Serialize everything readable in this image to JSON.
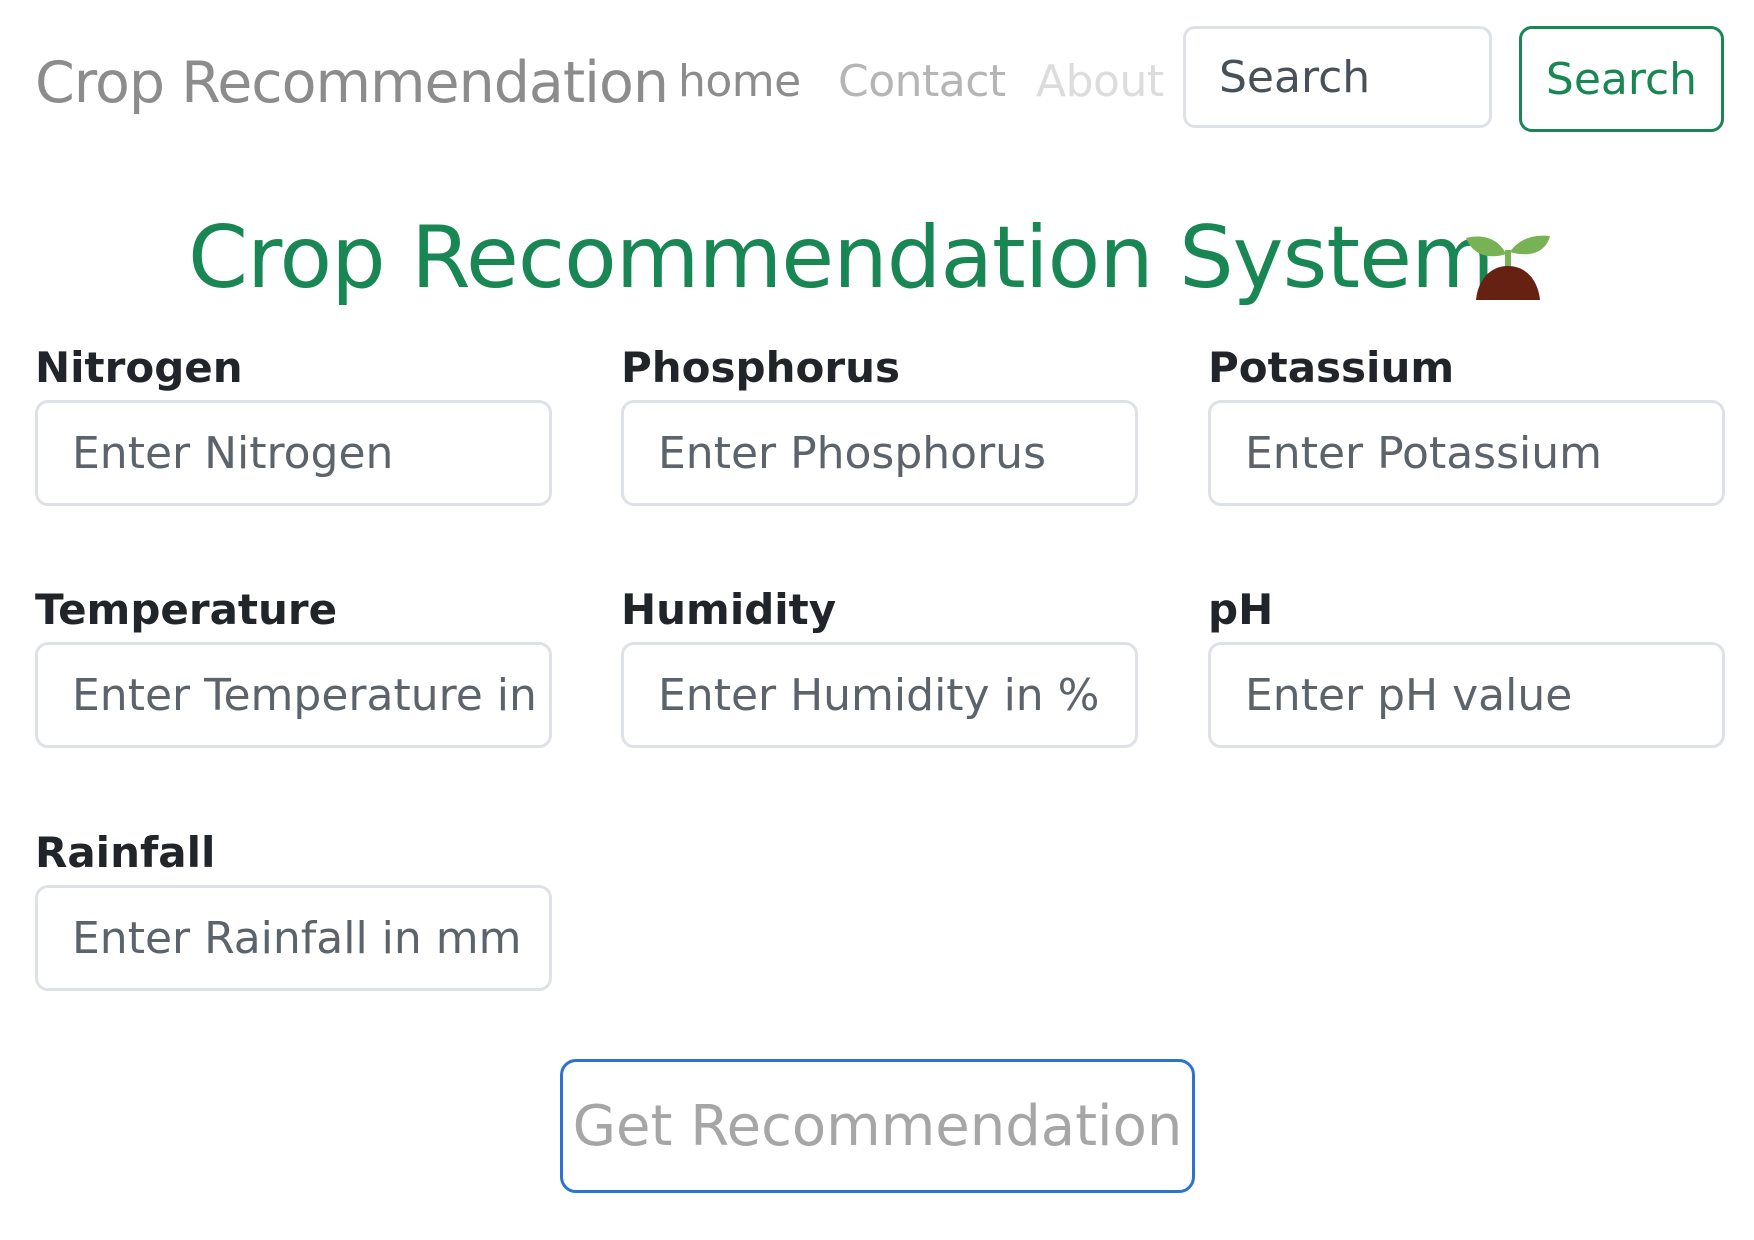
{
  "navbar": {
    "brand": "Crop Recommendation",
    "links": [
      "home",
      "Contact",
      "About"
    ],
    "search_placeholder": "Search",
    "search_button": "Search"
  },
  "main": {
    "title": "Crop Recommendation System",
    "title_icon": "seedling-icon",
    "fields": [
      {
        "label": "Nitrogen",
        "placeholder": "Enter Nitrogen",
        "value": ""
      },
      {
        "label": "Phosphorus",
        "placeholder": "Enter Phosphorus",
        "value": ""
      },
      {
        "label": "Potassium",
        "placeholder": "Enter Potassium",
        "value": ""
      },
      {
        "label": "Temperature",
        "placeholder": "Enter Temperature in °C",
        "value": ""
      },
      {
        "label": "Humidity",
        "placeholder": "Enter Humidity in %",
        "value": ""
      },
      {
        "label": "pH",
        "placeholder": "Enter pH value",
        "value": ""
      },
      {
        "label": "Rainfall",
        "placeholder": "Enter Rainfall in mm",
        "value": ""
      }
    ],
    "submit_label": "Get Recommendation"
  },
  "colors": {
    "accent_green": "#198754",
    "submit_border": "#2c72d2",
    "brand_gray": "#8c8c8c"
  }
}
